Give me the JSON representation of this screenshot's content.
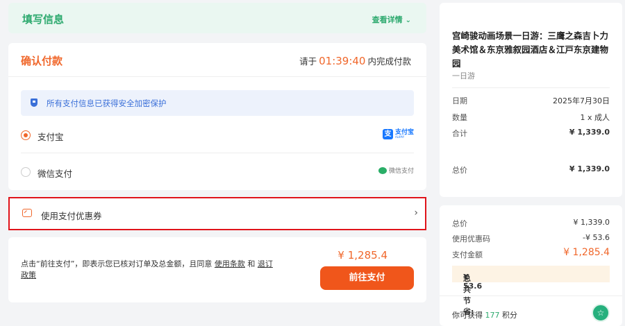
{
  "fill_info": {
    "title": "填写信息",
    "details_label": "查看详情",
    "details_icon": "chevron-down-icon"
  },
  "payment": {
    "title": "确认付款",
    "timer_prefix": "请于",
    "timer_value": "01:39:40",
    "timer_suffix": "内完成付款",
    "security_notice": "所有支付信息已获得安全加密保护",
    "options": [
      {
        "label": "支付宝",
        "selected": true,
        "logo_text": "支付宝",
        "logo_sub": "ALIPAY",
        "logo_glyph": "支"
      },
      {
        "label": "微信支付",
        "selected": false,
        "logo_text": "微信支付"
      }
    ]
  },
  "coupon": {
    "label": "使用支付优惠券"
  },
  "footer": {
    "agreement_prefix": "点击“前往支付”，即表示您已核对订单及总金额，且同意",
    "terms_link": "使用条款",
    "and": "和",
    "refund_link": "退订政策",
    "total_price": "¥ 1,285.4",
    "pay_button": "前往支付"
  },
  "summary": {
    "product_name": "宫崎骏动画场景一日游：三鹰之森吉卜力美术馆＆东京雅叙园酒店＆江戸东京建物园",
    "product_type": "一日游",
    "rows": [
      {
        "label": "日期",
        "value": "2025年7月30日"
      },
      {
        "label": "数量",
        "value": "1 x 成人"
      },
      {
        "label": "合计",
        "value": "¥ 1,339.0"
      }
    ],
    "total_label": "总价",
    "total_value": "¥ 1,339.0"
  },
  "price_breakdown": {
    "rows": [
      {
        "label": "总价",
        "value": "¥ 1,339.0"
      },
      {
        "label": "使用优惠码",
        "value": "-¥ 53.6"
      },
      {
        "label": "支付金额",
        "value": "¥ 1,285.4"
      }
    ],
    "saving_label": "总共节省:",
    "saving_value": "¥ 53.6",
    "points_prefix": "你可获得",
    "points_value": "177",
    "points_suffix": "积分"
  },
  "colors": {
    "accent": "#f0672b",
    "green": "#2eaa6f",
    "highlight_border": "#e0131a",
    "button": "#f0561b"
  }
}
